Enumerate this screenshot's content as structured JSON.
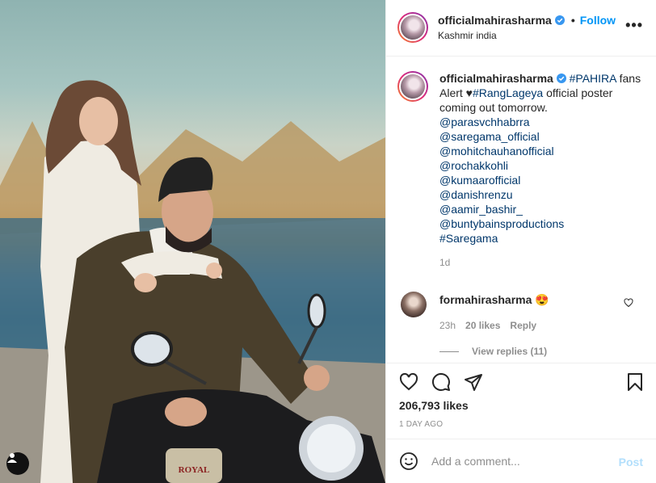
{
  "post": {
    "image_alt": "",
    "user_tag_icon": "person-icon"
  },
  "header": {
    "username": "officialmahirasharma",
    "separator": "•",
    "follow_label": "Follow",
    "location": "Kashmir india",
    "more_icon": "•••"
  },
  "caption": {
    "username": "officialmahirasharma",
    "text_start": "#PAHIRA",
    "text_mid": " fans Alert ♥",
    "hashtag_rang": "#RangLageya",
    "text_end": " official poster coming out tomorrow.",
    "tags": [
      "@parasvchhabrra",
      "@saregama_official",
      "@mohitchauhanofficial",
      "@rochakkohli",
      "@kumaarofficial",
      "@danishrenzu",
      "@aamir_bashir_",
      "@buntybainsproductions",
      "#Saregama"
    ],
    "time": "1d"
  },
  "reply": {
    "username": "formahirasharma",
    "text": "😍",
    "time": "23h",
    "likes": "20 likes",
    "reply_label": "Reply",
    "view_replies": "View replies (11)"
  },
  "actions": {
    "likes": "206,793 likes",
    "date": "1 DAY AGO"
  },
  "comment_box": {
    "placeholder": "Add a comment...",
    "post_label": "Post"
  },
  "colors": {
    "accent": "#0095f6",
    "link": "#00376b",
    "muted": "#8e8e8e",
    "post_disabled": "#b2dffc"
  }
}
